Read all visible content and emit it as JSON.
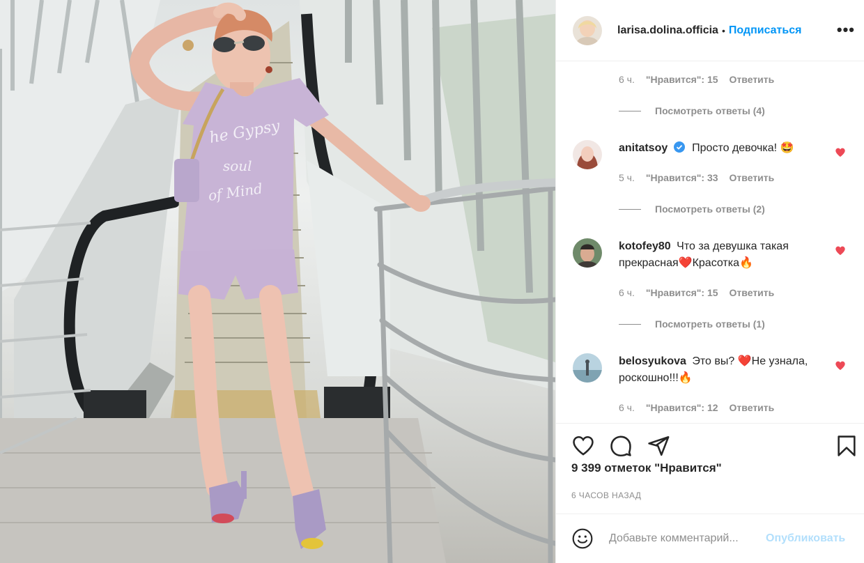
{
  "post": {
    "image_alt": "Woman in lilac t-shirt and shorts standing on an escalator",
    "shirt_print": [
      "he Gypsy",
      "soul",
      "of Mind"
    ]
  },
  "header": {
    "username": "larisa.dolina.officia",
    "separator": "•",
    "follow_label": "Подписаться",
    "more_icon": "more-horizontal-icon",
    "more_label": "•••"
  },
  "comments": {
    "top_meta": {
      "time": "6 ч.",
      "likes": "\"Нравится\": 15",
      "reply": "Ответить"
    },
    "top_replies": "Посмотреть ответы (4)",
    "items": [
      {
        "username": "anitatsoy",
        "verified": true,
        "text": "Просто девочка! 🤩",
        "time": "5 ч.",
        "likes": "\"Нравится\": 33",
        "reply": "Ответить",
        "replies": "Посмотреть ответы (2)"
      },
      {
        "username": "kotofey80",
        "text": "Что за девушка такая прекрасная❤️Красотка🔥",
        "time": "6 ч.",
        "likes": "\"Нравится\": 15",
        "reply": "Ответить",
        "replies": "Посмотреть ответы (1)"
      },
      {
        "username": "belosyukova",
        "text": "Это вы? ❤️Не узнала, роскошно!!!🔥",
        "time": "6 ч.",
        "likes": "\"Нравится\": 12",
        "reply": "Ответить"
      }
    ],
    "like_color": "#ed4956"
  },
  "actions": {
    "icons": [
      "heart-icon",
      "comment-icon",
      "share-icon",
      "bookmark-icon"
    ],
    "likes_count": "9 399 отметок \"Нравится\"",
    "timestamp": "6 ЧАСОВ НАЗАД"
  },
  "add_comment": {
    "placeholder": "Добавьте комментарий...",
    "post_label": "Опубликовать",
    "post_color": "#b2dffc"
  },
  "colors": {
    "accent": "#0095f6",
    "text": "#262626",
    "muted": "#8e8e8e",
    "divider": "#efefef"
  }
}
